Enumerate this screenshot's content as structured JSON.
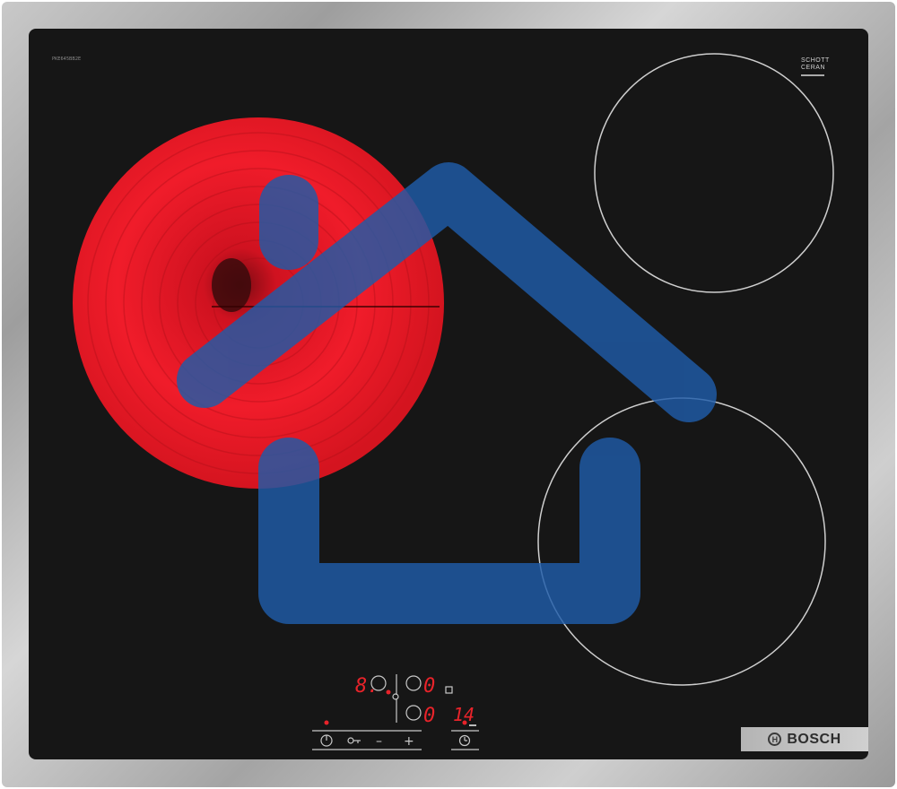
{
  "appliance": {
    "model_code": "PKE645BB2E",
    "glass_brand_line1": "SCHOTT",
    "glass_brand_line2": "CERAN",
    "brand_name": "BOSCH",
    "brand_logo_glyph": "H",
    "brand_logo_icon": "bosch-armature-icon"
  },
  "display": {
    "left_zone_level": "8.",
    "upper_right_level": "0",
    "lower_right_level": "0",
    "timer_value": "14"
  },
  "controls": {
    "power_icon": "power-icon",
    "lock_icon": "key-lock-icon",
    "minus_label": "–",
    "plus_label": "+",
    "timer_icon": "clock-icon"
  },
  "overlay": {
    "icon": "house-icon",
    "color": "#1f5ba8"
  },
  "colors": {
    "glass": "#161616",
    "heating_zone": "#e8232a",
    "display_led": "#e8232a"
  }
}
